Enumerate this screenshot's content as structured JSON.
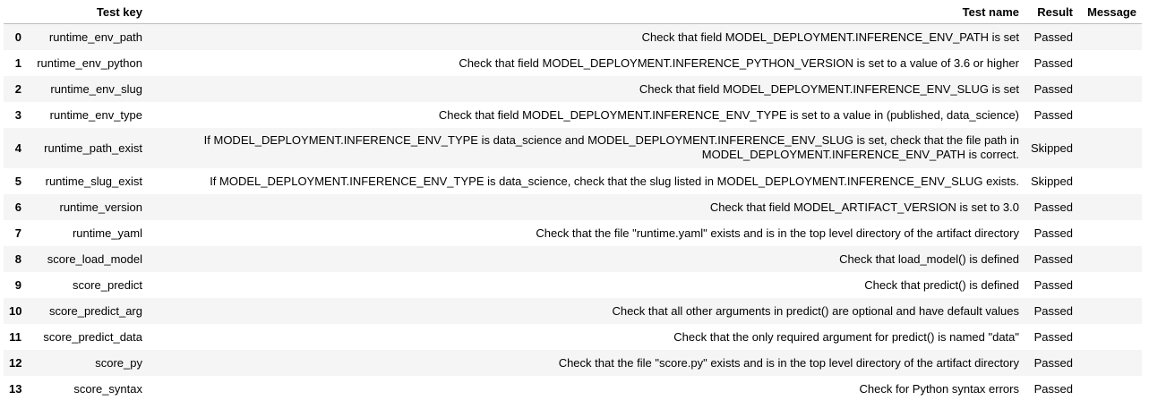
{
  "table": {
    "columns": {
      "index": "",
      "test_key": "Test key",
      "test_name": "Test name",
      "result": "Result",
      "message": "Message"
    },
    "rows": [
      {
        "index": "0",
        "test_key": "runtime_env_path",
        "test_name": "Check that field MODEL_DEPLOYMENT.INFERENCE_ENV_PATH is set",
        "result": "Passed",
        "message": ""
      },
      {
        "index": "1",
        "test_key": "runtime_env_python",
        "test_name": "Check that field MODEL_DEPLOYMENT.INFERENCE_PYTHON_VERSION is set to a value of 3.6 or higher",
        "result": "Passed",
        "message": ""
      },
      {
        "index": "2",
        "test_key": "runtime_env_slug",
        "test_name": "Check that field MODEL_DEPLOYMENT.INFERENCE_ENV_SLUG is set",
        "result": "Passed",
        "message": ""
      },
      {
        "index": "3",
        "test_key": "runtime_env_type",
        "test_name": "Check that field MODEL_DEPLOYMENT.INFERENCE_ENV_TYPE is set to a value in (published, data_science)",
        "result": "Passed",
        "message": ""
      },
      {
        "index": "4",
        "test_key": "runtime_path_exist",
        "test_name": "If MODEL_DEPLOYMENT.INFERENCE_ENV_TYPE is data_science and MODEL_DEPLOYMENT.INFERENCE_ENV_SLUG is set, check that the file path in MODEL_DEPLOYMENT.INFERENCE_ENV_PATH is correct.",
        "result": "Skipped",
        "message": ""
      },
      {
        "index": "5",
        "test_key": "runtime_slug_exist",
        "test_name": "If MODEL_DEPLOYMENT.INFERENCE_ENV_TYPE is data_science, check that the slug listed in MODEL_DEPLOYMENT.INFERENCE_ENV_SLUG exists.",
        "result": "Skipped",
        "message": ""
      },
      {
        "index": "6",
        "test_key": "runtime_version",
        "test_name": "Check that field MODEL_ARTIFACT_VERSION is set to 3.0",
        "result": "Passed",
        "message": ""
      },
      {
        "index": "7",
        "test_key": "runtime_yaml",
        "test_name": "Check that the file \"runtime.yaml\" exists and is in the top level directory of the artifact directory",
        "result": "Passed",
        "message": ""
      },
      {
        "index": "8",
        "test_key": "score_load_model",
        "test_name": "Check that load_model() is defined",
        "result": "Passed",
        "message": ""
      },
      {
        "index": "9",
        "test_key": "score_predict",
        "test_name": "Check that predict() is defined",
        "result": "Passed",
        "message": ""
      },
      {
        "index": "10",
        "test_key": "score_predict_arg",
        "test_name": "Check that all other arguments in predict() are optional and have default values",
        "result": "Passed",
        "message": ""
      },
      {
        "index": "11",
        "test_key": "score_predict_data",
        "test_name": "Check that the only required argument for predict() is named \"data\"",
        "result": "Passed",
        "message": ""
      },
      {
        "index": "12",
        "test_key": "score_py",
        "test_name": "Check that the file \"score.py\" exists and is in the top level directory of the artifact directory",
        "result": "Passed",
        "message": ""
      },
      {
        "index": "13",
        "test_key": "score_syntax",
        "test_name": "Check for Python syntax errors",
        "result": "Passed",
        "message": ""
      }
    ]
  }
}
